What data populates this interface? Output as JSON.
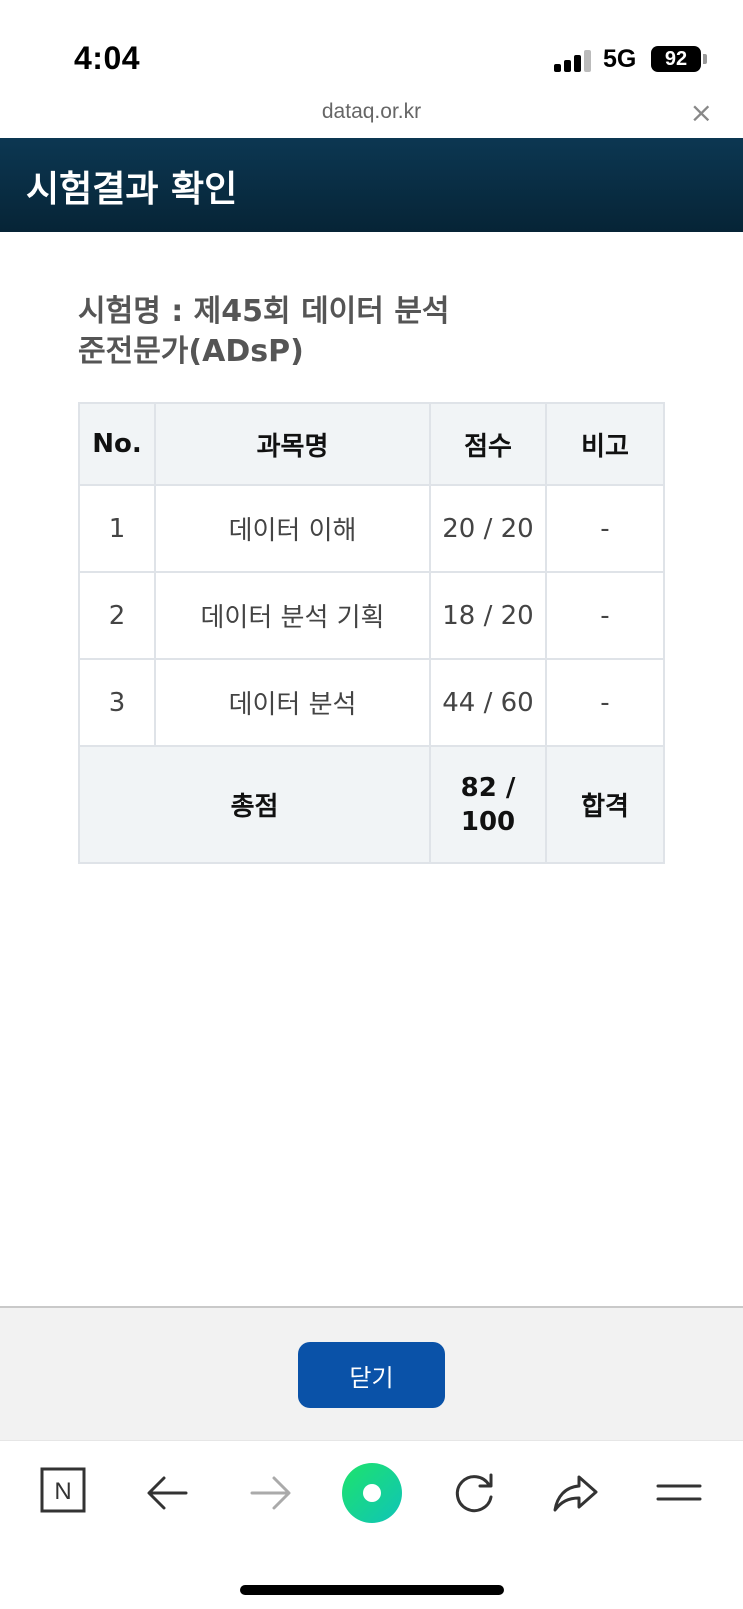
{
  "status_bar": {
    "time": "4:04",
    "network": "5G",
    "battery": "92"
  },
  "url_bar": {
    "domain": "dataq.or.kr",
    "close_symbol": "×"
  },
  "header": {
    "title": "시험결과 확인"
  },
  "exam": {
    "name_line1": "시험명 : 제45회 데이터 분석",
    "name_line2": "준전문가(ADsP)"
  },
  "table": {
    "headers": {
      "no": "No.",
      "subject": "과목명",
      "score": "점수",
      "note": "비고"
    },
    "rows": [
      {
        "no": "1",
        "subject": "데이터 이해",
        "score": "20 / 20",
        "note": "-"
      },
      {
        "no": "2",
        "subject": "데이터 분석 기획",
        "score": "18 / 20",
        "note": "-"
      },
      {
        "no": "3",
        "subject": "데이터 분석",
        "score": "44 / 60",
        "note": "-"
      }
    ],
    "total": {
      "label": "총점",
      "score_line1": "82 /",
      "score_line2": "100",
      "result": "합격"
    }
  },
  "footer": {
    "close_label": "닫기"
  },
  "toolbar": {
    "naver_label": "N",
    "icons": [
      "naver-icon",
      "back-arrow-icon",
      "forward-arrow-icon",
      "green-dot-icon",
      "reload-icon",
      "share-icon",
      "menu-icon"
    ]
  },
  "colors": {
    "header_bg": "#0c3752",
    "button_bg": "#0a52a8",
    "table_header_bg": "#f1f4f6",
    "green_dot": "#19d68a"
  }
}
